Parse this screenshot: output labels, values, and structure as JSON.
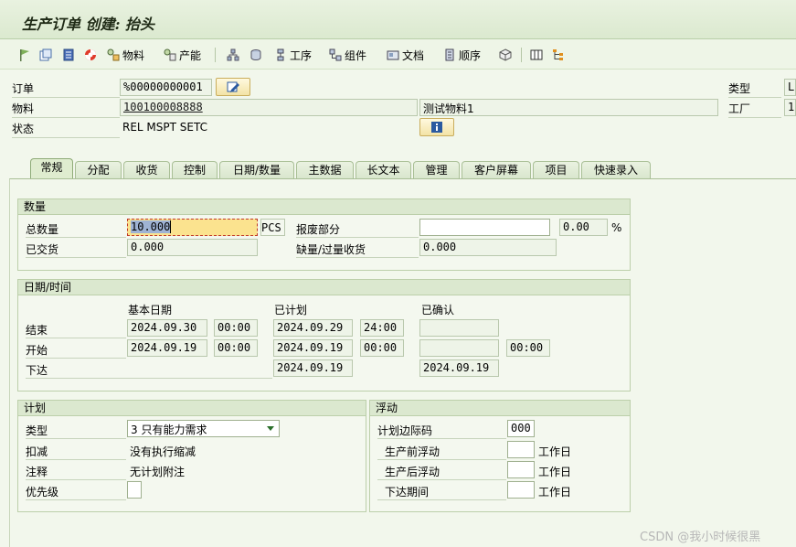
{
  "window": {
    "title": "生产订单 创建: 抬头"
  },
  "toolbar": {
    "material_label": "物料",
    "capacity_label": "产能",
    "operations_label": "工序",
    "components_label": "组件",
    "documents_label": "文档",
    "sequences_label": "顺序"
  },
  "header": {
    "order_label": "订单",
    "order_value": "%00000000001",
    "material_label": "物料",
    "material_value": "100100008888",
    "material_desc": "测试物料1",
    "status_label": "状态",
    "status_value": "REL  MSPT SETC",
    "type_label": "类型",
    "type_value": "L(",
    "plant_label": "工厂",
    "plant_value": "1"
  },
  "tabs": [
    "常规",
    "分配",
    "收货",
    "控制",
    "日期/数量",
    "主数据",
    "长文本",
    "管理",
    "客户屏幕",
    "项目",
    "快速录入"
  ],
  "quantity": {
    "group_title": "数量",
    "total_label": "总数量",
    "total_value": "10.000",
    "unit": "PCS",
    "scrap_label": "报废部分",
    "scrap_value": "",
    "scrap_pct": "0.00",
    "pct_sign": "%",
    "delivered_label": "已交货",
    "delivered_value": "0.000",
    "short_label": "缺量/过量收货",
    "short_value": "0.000"
  },
  "dates": {
    "group_title": "日期/时间",
    "col_basic": "基本日期",
    "col_scheduled": "已计划",
    "col_confirmed": "已确认",
    "end_label": "结束",
    "end_basic_date": "2024.09.30",
    "end_basic_time": "00:00",
    "end_sched_date": "2024.09.29",
    "end_sched_time": "24:00",
    "end_conf": "",
    "start_label": "开始",
    "start_basic_date": "2024.09.19",
    "start_basic_time": "00:00",
    "start_sched_date": "2024.09.19",
    "start_sched_time": "00:00",
    "start_conf_date": "",
    "start_conf_time": "00:00",
    "release_label": "下达",
    "release_sched": "2024.09.19",
    "release_conf": "2024.09.19"
  },
  "plan": {
    "group_title": "计划",
    "type_label": "类型",
    "type_value": "3 只有能力需求",
    "reduction_label": "扣减",
    "reduction_value": "没有执行缩减",
    "note_label": "注释",
    "note_value": "无计划附注",
    "priority_label": "优先级",
    "priority_value": ""
  },
  "float": {
    "group_title": "浮动",
    "margin_label": "计划边际码",
    "margin_value": "000",
    "pre_label": "生产前浮动",
    "pre_value": "",
    "post_label": "生产后浮动",
    "post_value": "",
    "release_label": "下达期间",
    "release_value": "",
    "unit": "工作日"
  },
  "watermark": "CSDN @我小时候很黑",
  "colors": {
    "accent": "#fbe38f",
    "background": "#f2f7ec",
    "group_header": "#dbe8cf"
  }
}
